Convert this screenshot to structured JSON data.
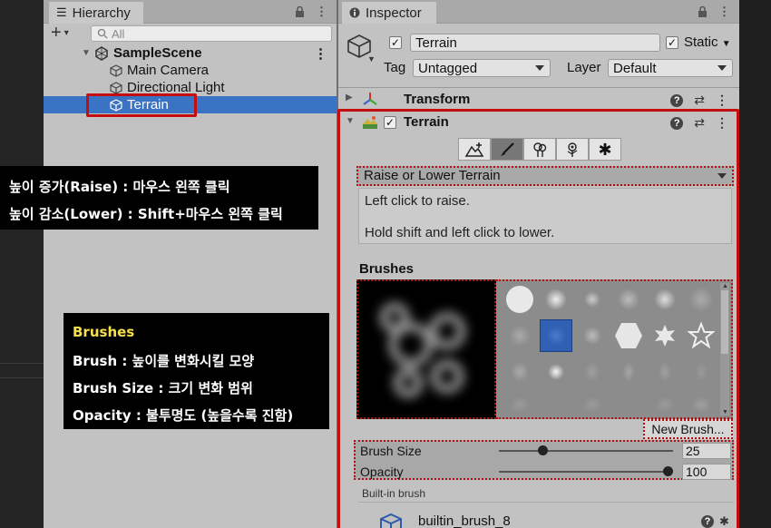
{
  "hierarchy": {
    "tab_title": "Hierarchy",
    "search_placeholder": "All",
    "scene_name": "SampleScene",
    "items": [
      {
        "label": "Main Camera"
      },
      {
        "label": "Directional Light"
      },
      {
        "label": "Terrain",
        "selected": true
      }
    ]
  },
  "inspector": {
    "tab_title": "Inspector",
    "object_name": "Terrain",
    "static_label": "Static",
    "tag_label": "Tag",
    "tag_value": "Untagged",
    "layer_label": "Layer",
    "layer_value": "Default",
    "components": {
      "transform": "Transform",
      "terrain": "Terrain"
    },
    "tool_mode": "Raise or Lower Terrain",
    "description_lines": [
      "Left click to raise.",
      "Hold shift and left click to lower."
    ],
    "brushes_header": "Brushes",
    "new_brush_label": "New Brush...",
    "brush_size_label": "Brush Size",
    "brush_size_value": "25",
    "opacity_label": "Opacity",
    "opacity_value": "100",
    "builtin_label": "Built-in brush",
    "selected_brush_name": "builtin_brush_8"
  },
  "overlays": {
    "raise_lower_lines": [
      "높이 증가(Raise) : 마우스 왼쪽 클릭",
      "높이 감소(Lower) : Shift+마우스 왼쪽 클릭"
    ],
    "brushes_title": "Brushes",
    "brushes_lines": [
      "Brush : 높이를 변화시킬 모양",
      "Brush Size : 크기 변화 범위",
      "Opacity : 불투명도 (높을수록 진함)"
    ]
  },
  "colors": {
    "selection": "#3a72c4",
    "highlight_red": "#c40d0d",
    "overlay_title": "#f5e04a"
  },
  "sliders": {
    "brush_size_fraction": 0.25,
    "opacity_fraction": 1.0
  }
}
